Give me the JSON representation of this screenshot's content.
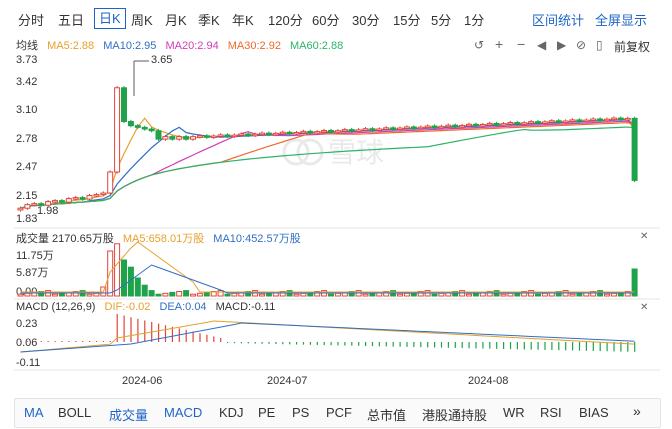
{
  "period_tabs": [
    "分时",
    "五日",
    "日K",
    "周K",
    "月K",
    "季K",
    "年K",
    "120分",
    "60分",
    "30分",
    "15分",
    "5分",
    "1分"
  ],
  "active_period": "日K",
  "tools": {
    "interval_stats": "区间统计",
    "fullscreen": "全屏显示"
  },
  "price_panel": {
    "label": "均线",
    "ma": [
      {
        "text": "MA5:2.88",
        "color": "#e8a02a"
      },
      {
        "text": "MA10:2.95",
        "color": "#2f6fc6"
      },
      {
        "text": "MA20:2.94",
        "color": "#d23cb6"
      },
      {
        "text": "MA30:2.92",
        "color": "#ef6a2c"
      },
      {
        "text": "MA60:2.88",
        "color": "#2cb36a"
      }
    ],
    "adjust": "前复权",
    "y_ticks": [
      "3.73",
      "3.42",
      "3.10",
      "2.78",
      "2.47",
      "2.15",
      "1.83"
    ],
    "high_marker": "3.65",
    "low_marker": "1.98",
    "watermark": "雪球"
  },
  "volume_panel": {
    "title": "成交量 2170.65万股",
    "ma5": "MA5:658.01万股",
    "ma10": "MA10:452.57万股",
    "ma5_color": "#e8a02a",
    "ma10_color": "#2f6fc6",
    "y_ticks": [
      "11.75万",
      "5.87万",
      "0.00"
    ]
  },
  "macd_panel": {
    "title": "MACD (12,26,9)",
    "dif": "DIF:-0.02",
    "dea": "DEA:0.04",
    "macd": "MACD:-0.11",
    "dif_color": "#e8a02a",
    "dea_color": "#2f6fc6",
    "macd_color": "#333333",
    "y_ticks": [
      "0.23",
      "0.06",
      "-0.11"
    ]
  },
  "date_labels": [
    "2024-06",
    "2024-07",
    "2024-08"
  ],
  "indicator_tabs": [
    "MA",
    "BOLL",
    "成交量",
    "MACD",
    "KDJ",
    "PE",
    "PS",
    "PCF",
    "总市值",
    "港股通持股",
    "WR",
    "RSI",
    "BIAS"
  ],
  "active_indicators": [
    "MA",
    "成交量",
    "MACD"
  ],
  "colors": {
    "up": "#e0443a",
    "down": "#1fa34a",
    "accent": "#1e64c8"
  },
  "icons": [
    "undo-icon",
    "zoom-in-icon",
    "zoom-out-icon",
    "pan-left-icon",
    "pan-right-icon",
    "reset-icon",
    "close-icon",
    "more-icon"
  ]
}
